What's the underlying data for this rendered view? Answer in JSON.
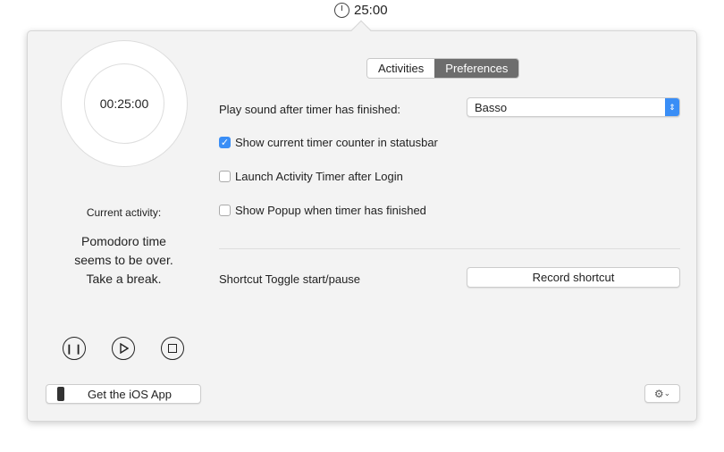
{
  "statusbar": {
    "time": "25:00"
  },
  "tabs": [
    {
      "label": "Activities",
      "active": false
    },
    {
      "label": "Preferences",
      "active": true
    }
  ],
  "timer": {
    "display": "00:25:00",
    "current_activity_label": "Current activity:",
    "message": [
      "Pomodoro time",
      "seems to be over.",
      "Take a break."
    ]
  },
  "controls": {
    "pause": "pause",
    "play": "play",
    "stop": "stop"
  },
  "ios_button": "Get the iOS App",
  "prefs": {
    "sound_label": "Play sound after timer has finished:",
    "sound_value": "Basso",
    "options": [
      {
        "label": "Show current timer counter in statusbar",
        "checked": true
      },
      {
        "label": "Launch Activity Timer after Login",
        "checked": false
      },
      {
        "label": "Show Popup when timer has finished",
        "checked": false
      }
    ],
    "shortcut_label": "Shortcut Toggle start/pause",
    "shortcut_button": "Record shortcut"
  },
  "colors": {
    "accent": "#3a8ef6"
  }
}
